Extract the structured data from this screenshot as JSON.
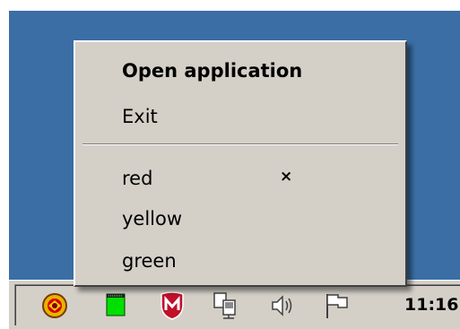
{
  "context_menu": {
    "items": [
      {
        "label": "Open application",
        "default": true
      },
      {
        "label": "Exit"
      }
    ],
    "color_items": [
      {
        "label": "red",
        "checked": true,
        "check_mark": "×"
      },
      {
        "label": "yellow",
        "checked": false
      },
      {
        "label": "green",
        "checked": false
      }
    ]
  },
  "taskbar": {
    "tray_icons": [
      "mcafee-agent-icon",
      "green-app-icon",
      "mcafee-shield-icon",
      "network-icon",
      "volume-icon",
      "action-center-flag-icon"
    ],
    "clock": "11:16"
  },
  "colors": {
    "desktop": "#3a6ea5",
    "menu_background": "#d4d0c8"
  }
}
